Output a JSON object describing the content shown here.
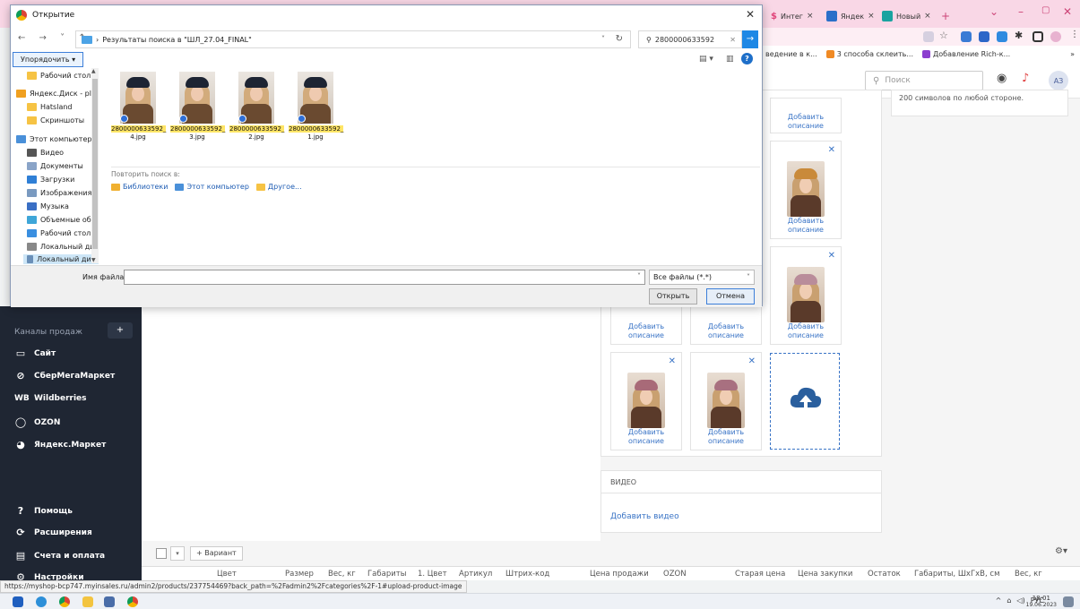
{
  "browser": {
    "tabs": [
      {
        "label": "Интег",
        "color": "#e0457b"
      },
      {
        "label": "Яндек",
        "color": "#2a6fc9"
      },
      {
        "label": "Новый",
        "color": "#1aa3a0"
      }
    ],
    "new_tab": "+",
    "bookmarks": [
      {
        "label": "ведение в к...",
        "color": "#ffffff"
      },
      {
        "label": "3 способа склеить...",
        "color": "#f08a24"
      },
      {
        "label": "Добавление Rich-к...",
        "color": "#8c3fcf"
      }
    ],
    "more_bookmarks": "»"
  },
  "site": {
    "search_placeholder": "Поиск",
    "avatar": "АЗ",
    "right_note": "200 символов по любой стороне.",
    "sidebar": {
      "section": "Каналы продаж",
      "add": "+",
      "channels": [
        {
          "label": "Сайт",
          "icon": "monitor-icon"
        },
        {
          "label": "СберМегаМаркет",
          "icon": "check-circle-icon"
        },
        {
          "label": "Wildberries",
          "icon": "wb-logo-icon"
        },
        {
          "label": "OZON",
          "icon": "ozon-logo-icon"
        },
        {
          "label": "Яндекс.Маркет",
          "icon": "yandex-market-icon"
        }
      ],
      "bottom": [
        {
          "label": "Помощь",
          "icon": "help-icon"
        },
        {
          "label": "Расширения",
          "icon": "extensions-icon"
        },
        {
          "label": "Счета и оплата",
          "icon": "billing-icon"
        },
        {
          "label": "Настройки",
          "icon": "settings-icon"
        }
      ]
    },
    "images": {
      "add_description": "Добавить описание",
      "hat_colors": [
        "#d9c2b0",
        "#c98a3a",
        "#b98c9a",
        "#b57a86",
        "#a86a78",
        "#a87080",
        "#8a5a6a"
      ]
    },
    "video": {
      "title": "ВИДЕО",
      "add": "Добавить видео"
    },
    "variants": {
      "add_variant": "+ Вариант",
      "columns": [
        "Цвет",
        "Размер",
        "Вес, кг",
        "Габариты",
        "1. Цвет",
        "Артикул",
        "Штрих-код",
        "Цена продажи",
        "OZON",
        "Старая цена",
        "Цена закупки",
        "Остаток",
        "Габариты, ШхГхВ, см",
        "Вес, кг"
      ]
    },
    "status_url": "https://myshop-bcp747.myinsales.ru/admin2/products/237754469?back_path=%2Fadmin2%2Fcategories%2F-1#upload-product-image"
  },
  "taskbar": {
    "tray_lang": "РУС",
    "time": "18:01",
    "date": "19.06.2023"
  },
  "dialog": {
    "title": "Открытие",
    "path": "Результаты поиска в \"ШЛ_27.04_FINAL\"",
    "search_value": "2800000633592",
    "arrange": "Упорядочить ▾",
    "nav_items": [
      {
        "label": "Рабочий стол",
        "color": "#f6c344"
      },
      {
        "label": "Яндекс.Диск - plr",
        "color": "#f0a020"
      },
      {
        "label": "Hatsland",
        "color": "#f6c344"
      },
      {
        "label": "Скриншоты",
        "color": "#f6c344"
      },
      {
        "label": "Этот компьютер",
        "color": "#4a90d9"
      },
      {
        "label": "Видео",
        "color": "#555555"
      },
      {
        "label": "Документы",
        "color": "#8aa4c8"
      },
      {
        "label": "Загрузки",
        "color": "#2f7fd6"
      },
      {
        "label": "Изображения",
        "color": "#7a9ac0"
      },
      {
        "label": "Музыка",
        "color": "#3a6fc4"
      },
      {
        "label": "Объемные объ",
        "color": "#3fa6d8"
      },
      {
        "label": "Рабочий стол",
        "color": "#3a8fe0"
      },
      {
        "label": "Локальный дис",
        "color": "#888888"
      },
      {
        "label": "Локальный дис",
        "color": "#6a8fb8"
      }
    ],
    "files": [
      {
        "name_hl": "2800000633592_",
        "name_rest": "4.jpg"
      },
      {
        "name_hl": "2800000633592_",
        "name_rest": "3.jpg"
      },
      {
        "name_hl": "2800000633592_",
        "name_rest": "2.jpg"
      },
      {
        "name_hl": "2800000633592_",
        "name_rest": "1.jpg"
      }
    ],
    "repeat_search": "Повторить поиск в:",
    "repeat_links": [
      {
        "label": "Библиотеки",
        "color": "#f0b030"
      },
      {
        "label": "Этот компьютер",
        "color": "#4a90d9"
      },
      {
        "label": "Другое...",
        "color": "#f6c344"
      }
    ],
    "filename_label": "Имя файла:",
    "filename_value": "",
    "filetype": "Все файлы (*.*)",
    "open": "Открыть",
    "cancel": "Отмена"
  }
}
